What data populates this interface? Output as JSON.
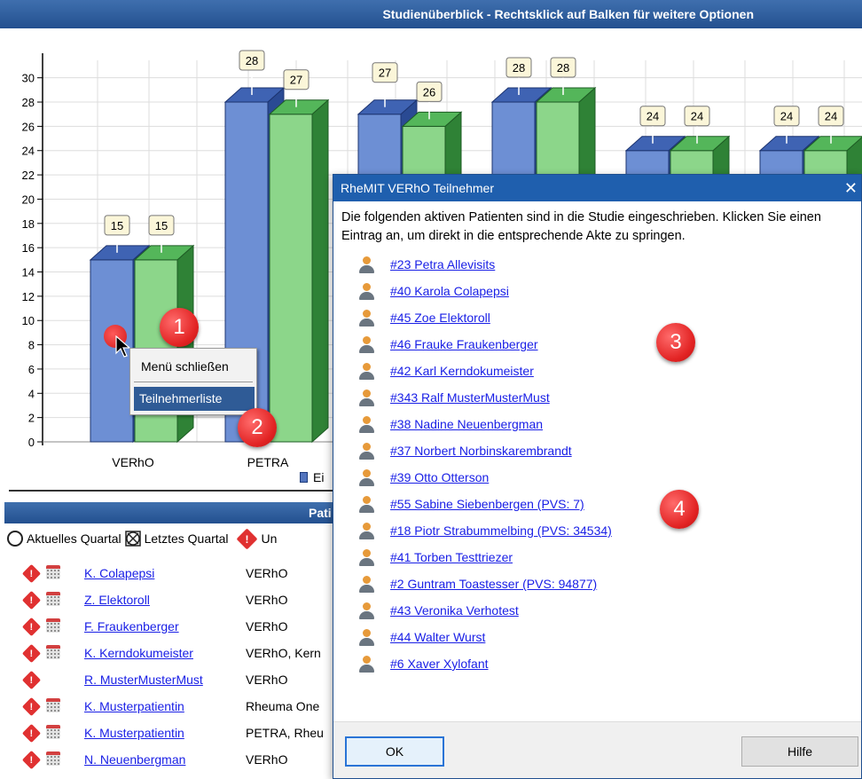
{
  "window": {
    "title": "Studienüberblick - Rechtsklick auf Balken für weitere Optionen"
  },
  "chart_data": {
    "type": "bar",
    "title": "Studienüberblick - Rechtsklick auf Balken für weitere Optionen",
    "ylim": [
      0,
      31
    ],
    "yticks": [
      0,
      2,
      4,
      6,
      8,
      10,
      12,
      14,
      16,
      18,
      20,
      22,
      24,
      26,
      28,
      30
    ],
    "categories": [
      "VERhO",
      "PETRA",
      "",
      "",
      "",
      ""
    ],
    "series": [
      {
        "color": "#6d8fd4",
        "values": [
          15,
          28,
          27,
          28,
          24,
          24
        ]
      },
      {
        "color": "#8cd68a",
        "values": [
          15,
          27,
          26,
          28,
          24,
          24
        ]
      }
    ],
    "legend": [
      "Ei"
    ],
    "grid": true
  },
  "context_menu": {
    "close_label": "Menü schließen",
    "list_label": "Teilnehmerliste"
  },
  "callouts": [
    "1",
    "2",
    "3",
    "4"
  ],
  "patients_panel": {
    "title": "Pati",
    "filter_current": "Aktuelles Quartal",
    "filter_last": "Letztes Quartal",
    "filter_warn": "Un",
    "rows": [
      {
        "name": "K. Colapepsi",
        "study": "VERhO",
        "calendar": true
      },
      {
        "name": "Z. Elektoroll",
        "study": "VERhO",
        "calendar": true
      },
      {
        "name": "F. Fraukenberger",
        "study": "VERhO",
        "calendar": true
      },
      {
        "name": "K. Kerndokumeister",
        "study": "VERhO, Kern",
        "calendar": true
      },
      {
        "name": "R. MusterMusterMust",
        "study": "VERhO",
        "calendar": false
      },
      {
        "name": "K. Musterpatientin",
        "study": "Rheuma One",
        "calendar": true
      },
      {
        "name": "K. Musterpatientin",
        "study": "PETRA, Rheu",
        "calendar": true
      },
      {
        "name": "N. Neuenbergman",
        "study": "VERhO",
        "calendar": true
      }
    ]
  },
  "dialog": {
    "title": "RheMIT VERhO Teilnehmer",
    "close_glyph": "✕",
    "description": "Die folgenden aktiven Patienten sind in die Studie eingeschrieben. Klicken Sie einen Eintrag an, um direkt in die entsprechende Akte zu springen.",
    "participants": [
      "#23 Petra Allevisits",
      "#40 Karola Colapepsi",
      "#45 Zoe Elektoroll",
      "#46 Frauke Fraukenberger",
      "#42 Karl Kerndokumeister",
      "#343 Ralf MusterMusterMust",
      "#38 Nadine Neuenbergman",
      "#37 Norbert Norbinskarembrandt",
      "#39 Otto Otterson",
      "#55 Sabine Siebenbergen (PVS: 7)",
      "#18 Piotr Strabummelbing (PVS: 34534)",
      "#41 Torben Testtriezer",
      "#2 Guntram Toastesser (PVS: 94877)",
      "#43 Veronika Verhotest",
      "#44 Walter Wurst",
      "#6 Xaver Xylofant"
    ],
    "ok_label": "OK",
    "help_label": "Hilfe"
  }
}
